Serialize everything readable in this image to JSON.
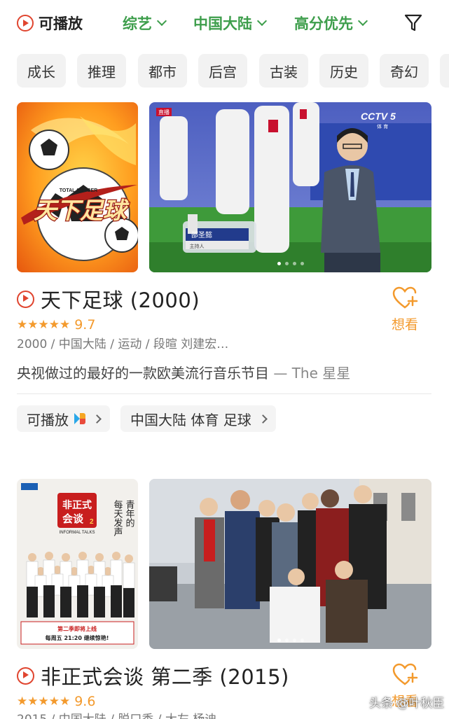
{
  "filter": {
    "playable_label": "可播放",
    "dropdowns": [
      "综艺",
      "中国大陆",
      "高分优先"
    ]
  },
  "tags": [
    "成长",
    "推理",
    "都市",
    "后宫",
    "古装",
    "历史",
    "奇幻"
  ],
  "items": [
    {
      "title": "天下足球 (2000)",
      "score": "9.7",
      "stars": "★★★★★",
      "meta": "2000 / 中国大陆 / 运动 / 段暄 刘建宏…",
      "comment": "央视做过的最好的一款欧美流行音乐节目",
      "comment_author": " — The 星星",
      "want_label": "想看",
      "playable_chip": "可播放",
      "genre_chip": "中国大陆 体育 足球",
      "poster_title": "天下足球",
      "poster_subtitle": "TOTAL SOCCER",
      "media_badge": "直播",
      "channel_logo": "CCTV 5",
      "channel_sub": "体 育",
      "caption_name": "邵圣懿",
      "caption_role": "主持人"
    },
    {
      "title": "非正式会谈 第二季 (2015)",
      "score": "9.6",
      "stars": "★★★★★",
      "meta": "2015 / 中国大陆 / 脱口秀 / 大左 杨迪",
      "want_label": "想看",
      "poster_title": "非正式会谈",
      "poster_season": "2",
      "poster_subtitle": "INFORMAL TALKS",
      "poster_slogan": "每天发声",
      "poster_slogan2": "青年的",
      "poster_footer": "第二季即将上线",
      "poster_footer2": "每周五 21:20 继续惊艳!"
    }
  ],
  "watermark": "头条 @叶秋臣"
}
